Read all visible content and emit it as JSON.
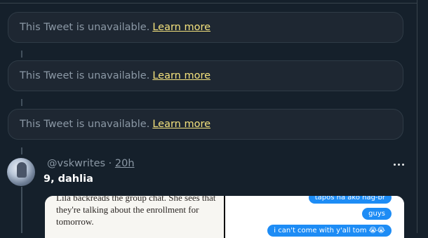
{
  "unavailable_cards": [
    {
      "message": "This Tweet is unavailable.",
      "link": "Learn more"
    },
    {
      "message": "This Tweet is unavailable.",
      "link": "Learn more"
    },
    {
      "message": "This Tweet is unavailable.",
      "link": "Learn more"
    }
  ],
  "tweet": {
    "handle": "@vskwrites",
    "separator": " · ",
    "time": "20h",
    "text": "9, dahlia",
    "more_icon": "more-horizontal-icon",
    "media": {
      "page_lines": [
        "Lila backreads the group chat. She sees that",
        "they're talking about the enrollment for",
        "tomorrow."
      ],
      "chat_bubbles": [
        "tapos na ako nag-br",
        "guys",
        "i can't come with y'all tom 😭😭"
      ]
    }
  },
  "colors": {
    "background": "#15202b",
    "card": "#1e2732",
    "link": "#f4e27d",
    "muted": "#8b98a5",
    "bubble": "#1d8cf5"
  }
}
